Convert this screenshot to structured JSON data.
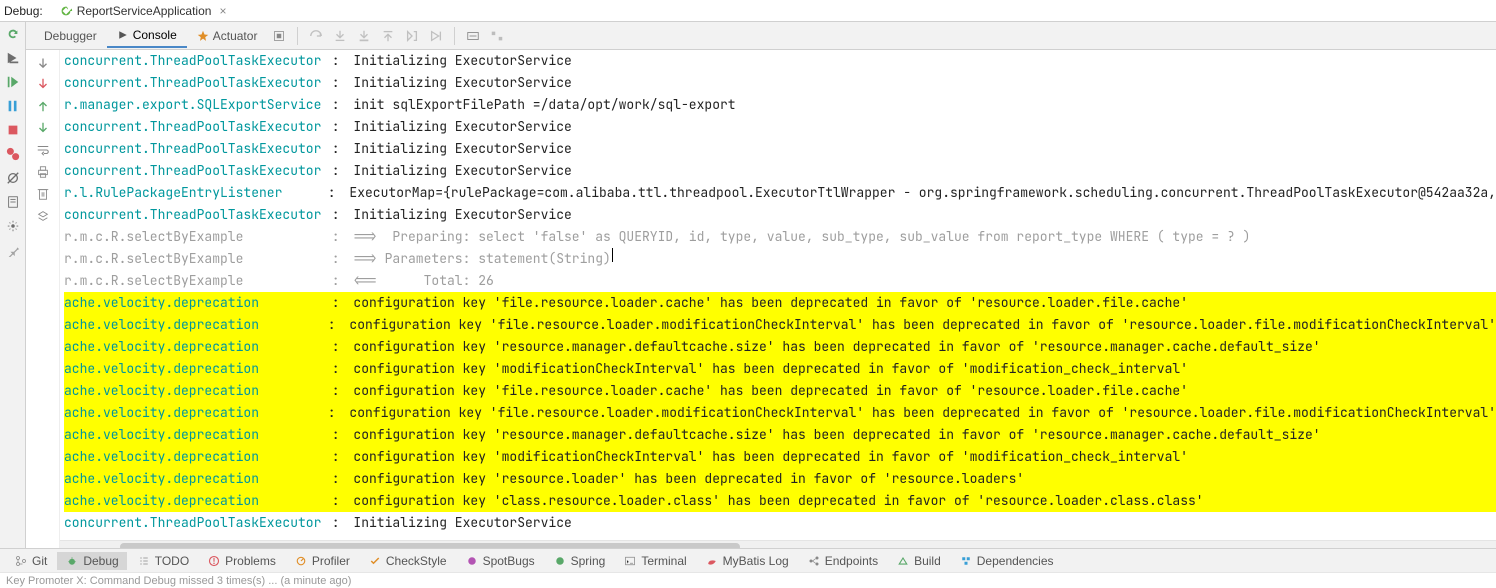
{
  "header": {
    "label": "Debug:",
    "run_config": "ReportServiceApplication"
  },
  "tabs": {
    "debugger": "Debugger",
    "console": "Console",
    "actuator": "Actuator"
  },
  "log": [
    {
      "style": "norm",
      "logger": "concurrent.ThreadPoolTaskExecutor",
      "msg": "Initializing ExecutorService"
    },
    {
      "style": "norm",
      "logger": "concurrent.ThreadPoolTaskExecutor",
      "msg": "Initializing ExecutorService"
    },
    {
      "style": "norm",
      "logger": "r.manager.export.SQLExportService",
      "msg": "init sqlExportFilePath =/data/opt/work/sql-export"
    },
    {
      "style": "norm",
      "logger": "concurrent.ThreadPoolTaskExecutor",
      "msg": "Initializing ExecutorService"
    },
    {
      "style": "norm",
      "logger": "concurrent.ThreadPoolTaskExecutor",
      "msg": "Initializing ExecutorService"
    },
    {
      "style": "norm",
      "logger": "concurrent.ThreadPoolTaskExecutor",
      "msg": "Initializing ExecutorService"
    },
    {
      "style": "norm",
      "logger": "r.l.RulePackageEntryListener",
      "msg": "ExecutorMap={rulePackage=com.alibaba.ttl.threadpool.ExecutorTtlWrapper - org.springframework.scheduling.concurrent.ThreadPoolTaskExecutor@542aa32a,"
    },
    {
      "style": "norm",
      "logger": "concurrent.ThreadPoolTaskExecutor",
      "msg": "Initializing ExecutorService"
    },
    {
      "style": "grey",
      "logger": "r.m.c.R.selectByExample",
      "msg": "==>  Preparing: select 'false' as QUERYID, id, type, value, sub_type, sub_value from report_type WHERE ( type = ? )"
    },
    {
      "style": "grey",
      "logger": "r.m.c.R.selectByExample",
      "msg": "==> Parameters: statement(String)",
      "caret": true
    },
    {
      "style": "grey",
      "logger": "r.m.c.R.selectByExample",
      "msg": "<==      Total: 26"
    },
    {
      "style": "hl",
      "logger": "ache.velocity.deprecation",
      "msg": "configuration key 'file.resource.loader.cache' has been deprecated in favor of 'resource.loader.file.cache'"
    },
    {
      "style": "hl",
      "logger": "ache.velocity.deprecation",
      "msg": "configuration key 'file.resource.loader.modificationCheckInterval' has been deprecated in favor of 'resource.loader.file.modificationCheckInterval'"
    },
    {
      "style": "hl",
      "logger": "ache.velocity.deprecation",
      "msg": "configuration key 'resource.manager.defaultcache.size' has been deprecated in favor of 'resource.manager.cache.default_size'"
    },
    {
      "style": "hl",
      "logger": "ache.velocity.deprecation",
      "msg": "configuration key 'modificationCheckInterval' has been deprecated in favor of 'modification_check_interval'"
    },
    {
      "style": "hl",
      "logger": "ache.velocity.deprecation",
      "msg": "configuration key 'file.resource.loader.cache' has been deprecated in favor of 'resource.loader.file.cache'"
    },
    {
      "style": "hl",
      "logger": "ache.velocity.deprecation",
      "msg": "configuration key 'file.resource.loader.modificationCheckInterval' has been deprecated in favor of 'resource.loader.file.modificationCheckInterval'"
    },
    {
      "style": "hl",
      "logger": "ache.velocity.deprecation",
      "msg": "configuration key 'resource.manager.defaultcache.size' has been deprecated in favor of 'resource.manager.cache.default_size'"
    },
    {
      "style": "hl",
      "logger": "ache.velocity.deprecation",
      "msg": "configuration key 'modificationCheckInterval' has been deprecated in favor of 'modification_check_interval'"
    },
    {
      "style": "hl",
      "logger": "ache.velocity.deprecation",
      "msg": "configuration key 'resource.loader' has been deprecated in favor of 'resource.loaders'"
    },
    {
      "style": "hl",
      "logger": "ache.velocity.deprecation",
      "msg": "configuration key 'class.resource.loader.class' has been deprecated in favor of 'resource.loader.class.class'"
    },
    {
      "style": "norm",
      "logger": "concurrent.ThreadPoolTaskExecutor",
      "msg": "Initializing ExecutorService"
    }
  ],
  "bottom": {
    "git": "Git",
    "debug": "Debug",
    "todo": "TODO",
    "problems": "Problems",
    "profiler": "Profiler",
    "checkstyle": "CheckStyle",
    "spotbugs": "SpotBugs",
    "spring": "Spring",
    "terminal": "Terminal",
    "mybatis": "MyBatis Log",
    "endpoints": "Endpoints",
    "build": "Build",
    "dependencies": "Dependencies"
  },
  "status": "Key Promoter X: Command Debug missed 3 times(s) ... (a minute ago)"
}
